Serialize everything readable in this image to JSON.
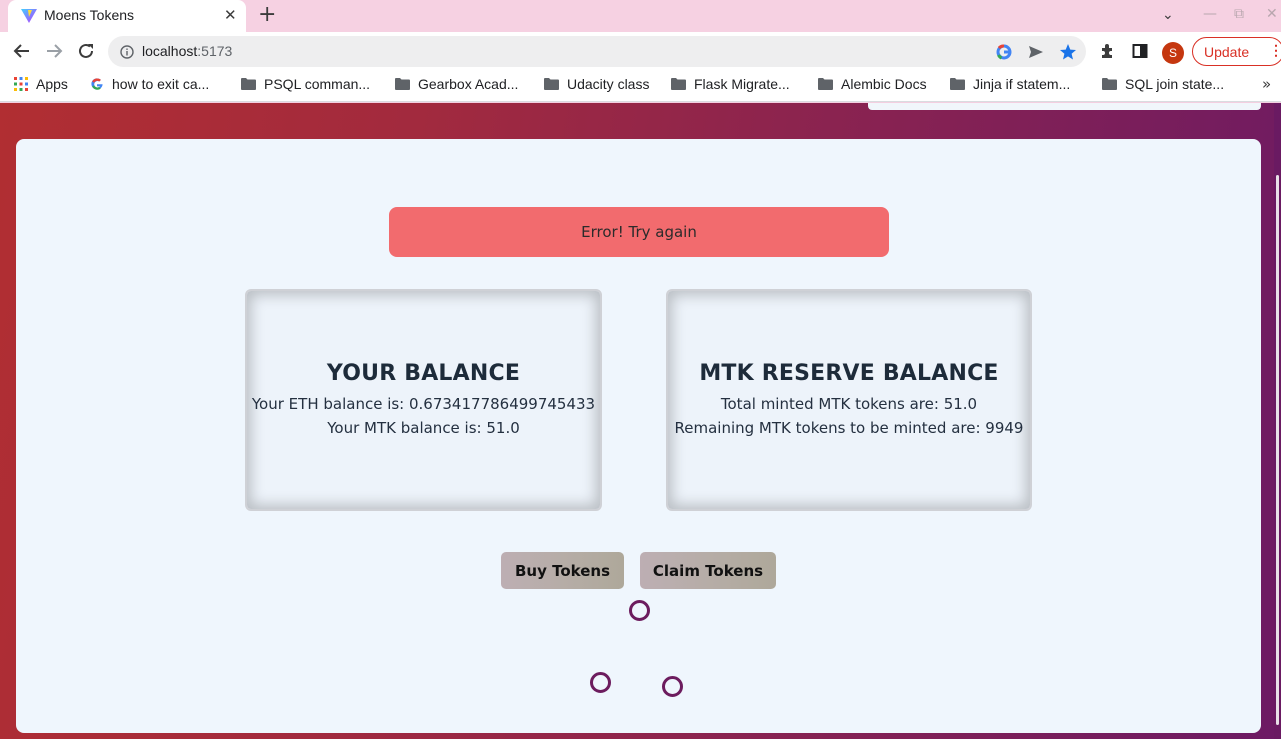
{
  "browser": {
    "tab": {
      "title": "Moens Tokens",
      "close_glyph": "✕"
    },
    "new_tab_glyph": "+",
    "tab_search_glyph": "⌄",
    "window_controls": {
      "minimize": "—",
      "restore": "⧉",
      "close": "✕"
    },
    "address": {
      "host": "localhost",
      "port": ":5173"
    },
    "profile_initial": "S",
    "update_label": "Update",
    "update_menu_glyph": "⋮",
    "bookmarks_more_glyph": "»",
    "bookmarks": [
      {
        "label": "Apps",
        "icon": "apps-grid-icon"
      },
      {
        "label": "how to exit ca...",
        "icon": "google-icon"
      },
      {
        "label": "PSQL comman...",
        "icon": "folder-icon"
      },
      {
        "label": "Gearbox Acad...",
        "icon": "folder-icon"
      },
      {
        "label": "Udacity class",
        "icon": "folder-icon"
      },
      {
        "label": "Flask Migrate...",
        "icon": "folder-icon"
      },
      {
        "label": "Alembic Docs",
        "icon": "folder-icon"
      },
      {
        "label": "Jinja if statem...",
        "icon": "folder-icon"
      },
      {
        "label": "SQL join state...",
        "icon": "folder-icon"
      }
    ]
  },
  "page": {
    "error_message": "Error! Try again",
    "your_balance": {
      "title": "YOUR BALANCE",
      "eth_line": "Your ETH balance is: 0.673417786499745433",
      "mtk_line": "Your MTK balance is: 51.0"
    },
    "reserve_balance": {
      "title": "MTK RESERVE BALANCE",
      "minted_line": "Total minted MTK tokens are: 51.0",
      "remaining_line": "Remaining MTK tokens to be minted are: 9949"
    },
    "buttons": {
      "buy": "Buy Tokens",
      "claim": "Claim Tokens"
    }
  },
  "colors": {
    "error_bg": "#f26b6e",
    "card_bg": "#eff6fd",
    "spinner": "#6c1c5e",
    "gradient_start": "#b12e32",
    "gradient_end": "#6c1a64"
  }
}
